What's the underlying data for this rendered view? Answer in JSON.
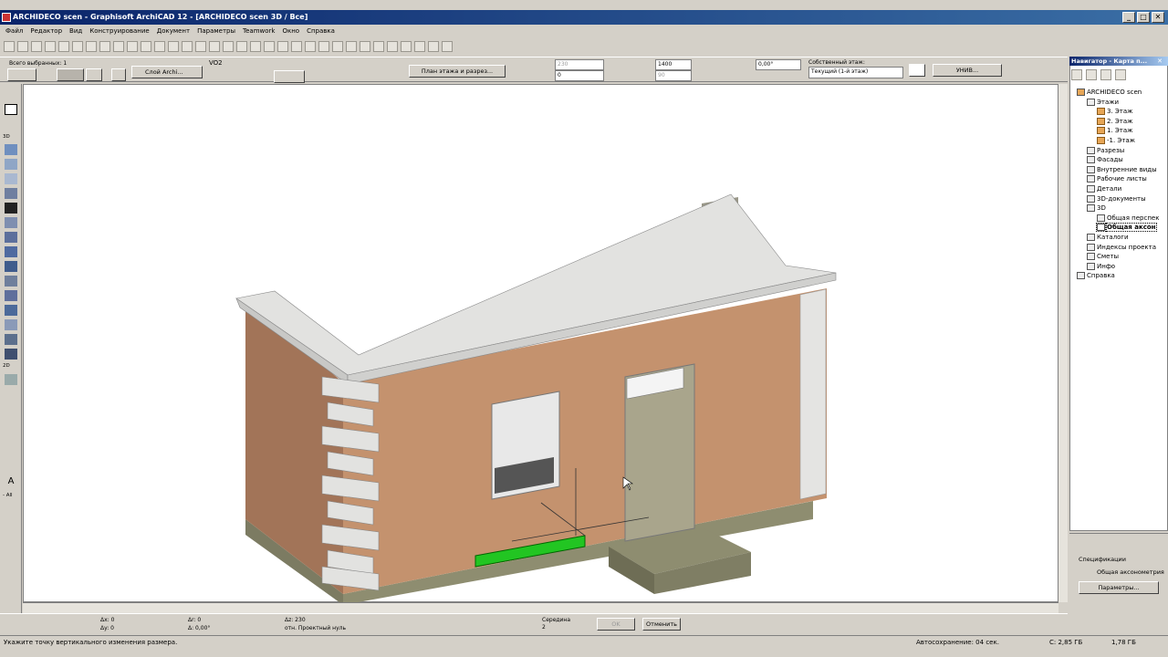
{
  "window": {
    "title": "ARCHIDECO scen - Graphisoft ArchiCAD 12 - [ARCHIDECO scen 3D / Все]",
    "controls": [
      "_",
      "□",
      "✕"
    ]
  },
  "menu": [
    "Файл",
    "Редактор",
    "Вид",
    "Конструирование",
    "Документ",
    "Параметры",
    "Teamwork",
    "Окно",
    "Справка"
  ],
  "infobox": {
    "selected": "Всего выбранных: 1",
    "layer_label": "Слой Archi...",
    "layer_code": "VO2",
    "plan_button": "План этажа и разрез...",
    "height_top": "230",
    "height_bottom": "0",
    "dim1": "1400",
    "dim2": "90",
    "angle": "0,00°",
    "own_floor_label": "Собственный этаж:",
    "own_floor_value": "Текущий (1-й этаж)",
    "univ_button": "УНИВ..."
  },
  "toolbox": {
    "label_3d": "3D",
    "label_2d": "2D",
    "label_all": "- All"
  },
  "navigator": {
    "title": "Навигатор - Карта п...",
    "tree": [
      {
        "label": "ARCHIDECO scen",
        "level": 0,
        "icon": "house",
        "exp": "−"
      },
      {
        "label": "Этажи",
        "level": 1,
        "icon": "stack",
        "exp": "▾"
      },
      {
        "label": "3. Этаж",
        "level": 2,
        "icon": "folder"
      },
      {
        "label": "2. Этаж",
        "level": 2,
        "icon": "folder"
      },
      {
        "label": "1. Этаж",
        "level": 2,
        "icon": "folder"
      },
      {
        "label": "-1. Этаж",
        "level": 2,
        "icon": "folder"
      },
      {
        "label": "Разрезы",
        "level": 1,
        "icon": "section"
      },
      {
        "label": "Фасады",
        "level": 1,
        "icon": "elevation"
      },
      {
        "label": "Внутренние виды",
        "level": 1,
        "icon": "interior"
      },
      {
        "label": "Рабочие листы",
        "level": 1,
        "icon": "worksheet"
      },
      {
        "label": "Детали",
        "level": 1,
        "icon": "detail"
      },
      {
        "label": "3D-документы",
        "level": 1,
        "icon": "doc3d"
      },
      {
        "label": "3D",
        "level": 1,
        "icon": "view3d",
        "exp": "▾"
      },
      {
        "label": "Общая перспек",
        "level": 2,
        "icon": "camera"
      },
      {
        "label": "Общая аксон",
        "level": 2,
        "icon": "axon",
        "selected": true
      },
      {
        "label": "Каталоги",
        "level": 1,
        "icon": "catalog",
        "exp": "▸"
      },
      {
        "label": "Индексы проекта",
        "level": 1,
        "icon": "index",
        "exp": "▸"
      },
      {
        "label": "Сметы",
        "level": 1,
        "icon": "estimate",
        "exp": "▸"
      },
      {
        "label": "Инфо",
        "level": 1,
        "icon": "info",
        "exp": "▸"
      },
      {
        "label": "Справка",
        "level": 0,
        "icon": "help",
        "exp": "▸"
      }
    ],
    "spec_label": "Спецификации",
    "spec_value": "Общая аксонометрия",
    "params_button": "Параметры..."
  },
  "coords": {
    "dx": "Δx: 0",
    "dy": "Δy: 0",
    "dr": "Δr: 0",
    "da": "Δ: 0,00°",
    "dz": "Δz: 230",
    "ref": "отн. Проектный нуль",
    "snap": "Середина",
    "snap_sub": "2",
    "ok": "OK",
    "cancel": "Отменить"
  },
  "status": {
    "hint": "Укажите точку вертикального изменения размера.",
    "autosave": "Автосохранение: 04 сек.",
    "disk_c": "C: 2,85 ГБ",
    "mem": "1,78 ГБ"
  },
  "colors": {
    "wall": "#c4926e",
    "wall_shade": "#a27458",
    "cornice": "#d0d0ce",
    "plinth": "#8e8d70",
    "door": "#a9a58c",
    "selection": "#22c522",
    "titlebar": "#0a246a"
  }
}
